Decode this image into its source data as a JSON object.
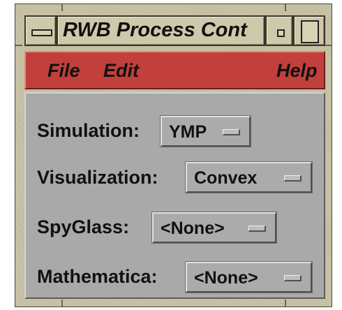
{
  "window": {
    "title": "RWB Process Cont"
  },
  "menubar": {
    "file": "File",
    "edit": "Edit",
    "help": "Help"
  },
  "fields": {
    "simulation": {
      "label": "Simulation:",
      "value": "YMP"
    },
    "visualization": {
      "label": "Visualization:",
      "value": "Convex"
    },
    "spyglass": {
      "label": "SpyGlass:",
      "value": "<None>"
    },
    "mathematica": {
      "label": "Mathematica:",
      "value": "<None>"
    }
  },
  "colors": {
    "menubar": "#c1403c",
    "panel": "#a9a9a9",
    "frame": "#c9c3a4"
  }
}
